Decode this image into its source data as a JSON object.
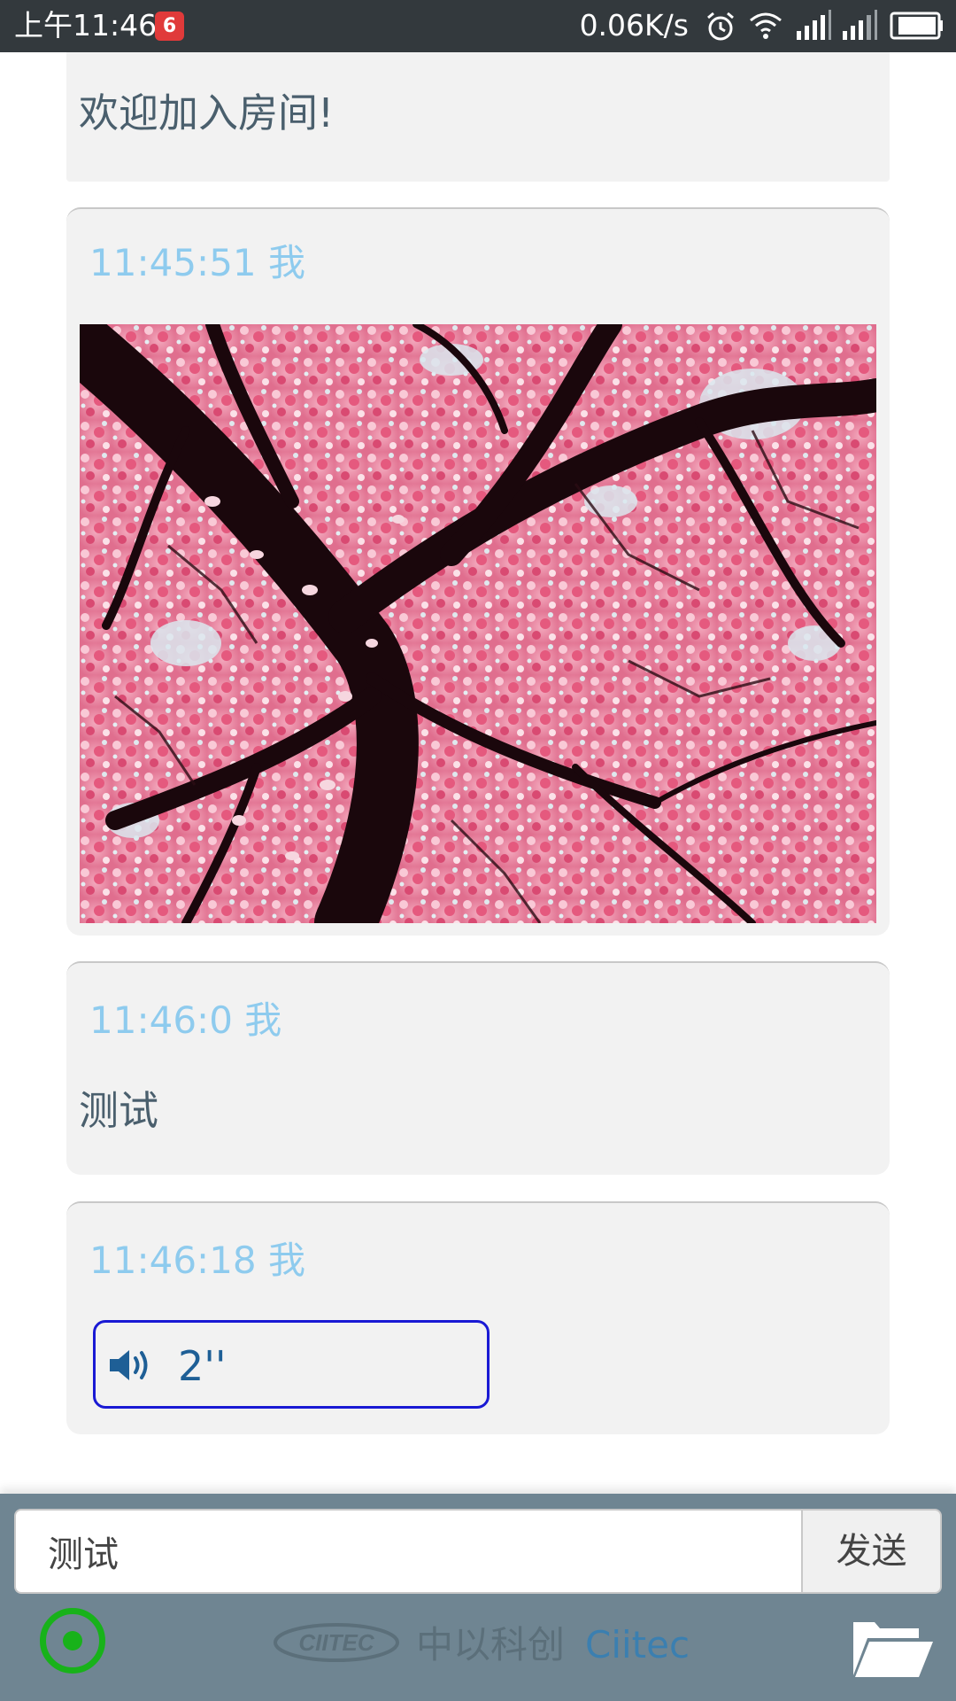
{
  "status_bar": {
    "time": "上午11:46",
    "netease_badge": "6",
    "network_speed": "0.06K/s",
    "icons": [
      "alarm-icon",
      "wifi-icon",
      "signal-icon",
      "signal-icon",
      "battery-icon"
    ]
  },
  "chat": {
    "welcome_text": "欢迎加入房间!",
    "messages": [
      {
        "meta": "11:45:51 我",
        "type": "image",
        "image_alt": "cherry blossom tree"
      },
      {
        "meta": "11:46:0 我",
        "type": "text",
        "text": "测试"
      },
      {
        "meta": "11:46:18 我",
        "type": "voice",
        "duration": "2''",
        "icon": "speaker-icon"
      }
    ]
  },
  "input_bar": {
    "value": "测试",
    "send_label": "发送"
  },
  "footer": {
    "brand_logo_text": "CIITEC",
    "brand_name": "中以科创",
    "brand_name_en": "Ciitec",
    "record_icon": "record-icon",
    "folder_icon": "folder-open-icon"
  },
  "colors": {
    "status_bar": "#33393d",
    "bubble": "#f2f2f2",
    "meta_text": "#8ecbee",
    "body_text": "#4a5f6d",
    "footer": "#6f8592",
    "record_green": "#18b21a",
    "voice_border": "#1a1ad4"
  }
}
